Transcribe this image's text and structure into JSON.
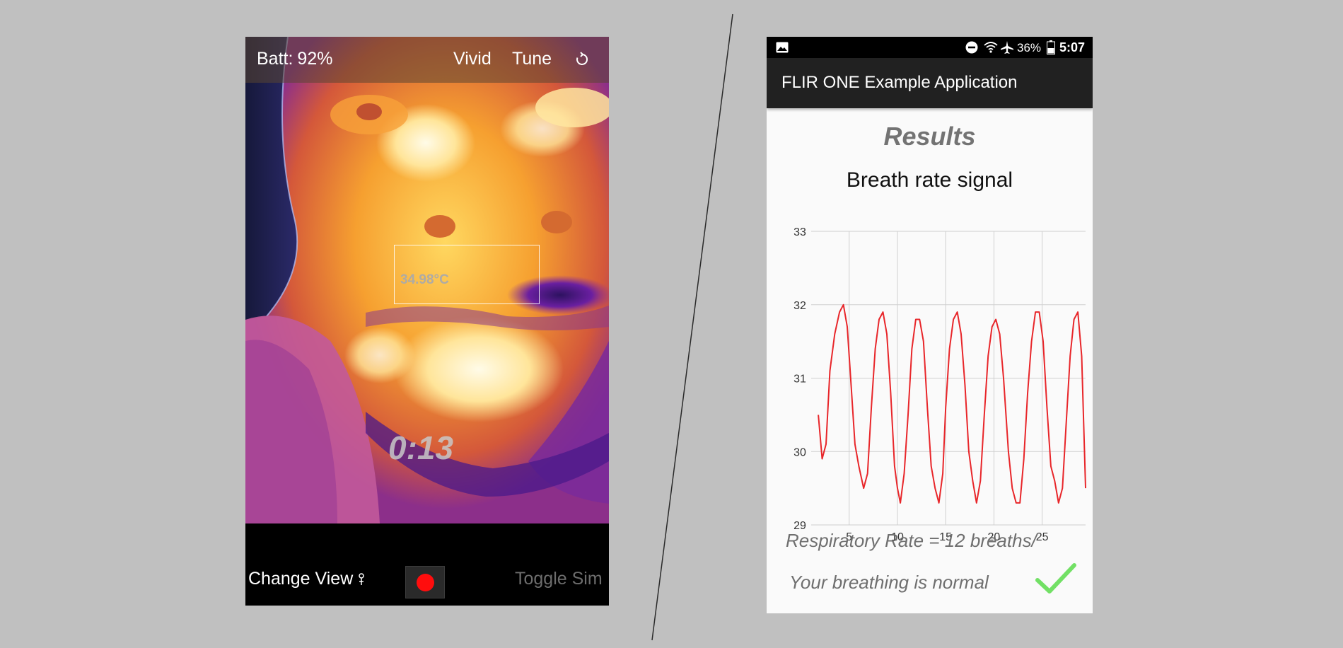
{
  "thermal_app": {
    "battery_label": "Batt:",
    "battery_value": "92%",
    "palette_label": "Vivid",
    "tune_label": "Tune",
    "roi_temperature": "34.98°C",
    "timer": "0:13",
    "change_view_label": "Change View",
    "toggle_sim_label": "Toggle Sim"
  },
  "results_app": {
    "status_bar": {
      "battery_pct": "36%",
      "time": "5:07"
    },
    "app_title": "FLIR ONE Example Application",
    "heading": "Results",
    "respiratory_rate_text": "Respiratory Rate = 12 breaths/",
    "breathing_status_text": "Your breathing is normal",
    "check_color": "#72e065"
  },
  "chart_data": {
    "type": "line",
    "title": "Breath rate signal",
    "xlabel": "",
    "ylabel": "",
    "xlim": [
      1.5,
      29.5
    ],
    "ylim": [
      29,
      33
    ],
    "x_ticks": [
      5,
      10,
      15,
      20,
      25
    ],
    "y_ticks": [
      29,
      30,
      31,
      32,
      33
    ],
    "grid": true,
    "series": [
      {
        "color": "#e8262a",
        "x": [
          1.8,
          2.2,
          2.6,
          3.0,
          3.5,
          4.0,
          4.4,
          4.8,
          5.2,
          5.6,
          6.0,
          6.5,
          6.9,
          7.3,
          7.7,
          8.1,
          8.5,
          8.9,
          9.3,
          9.7,
          10.0,
          10.3,
          10.7,
          11.1,
          11.5,
          11.9,
          12.3,
          12.7,
          13.1,
          13.5,
          13.9,
          14.3,
          14.7,
          15.0,
          15.4,
          15.8,
          16.2,
          16.6,
          17.0,
          17.4,
          17.8,
          18.2,
          18.6,
          19.0,
          19.4,
          19.8,
          20.2,
          20.6,
          21.0,
          21.5,
          21.9,
          22.3,
          22.7,
          23.1,
          23.5,
          23.9,
          24.3,
          24.7,
          25.1,
          25.5,
          25.9,
          26.3,
          26.7,
          27.1,
          27.5,
          27.9,
          28.3,
          28.7,
          29.1,
          29.5
        ],
        "y": [
          30.5,
          29.9,
          30.1,
          31.1,
          31.6,
          31.9,
          32.0,
          31.7,
          30.9,
          30.1,
          29.8,
          29.5,
          29.7,
          30.6,
          31.4,
          31.8,
          31.9,
          31.6,
          30.8,
          29.8,
          29.5,
          29.3,
          29.7,
          30.5,
          31.4,
          31.8,
          31.8,
          31.5,
          30.6,
          29.8,
          29.5,
          29.3,
          29.7,
          30.6,
          31.4,
          31.8,
          31.9,
          31.6,
          30.9,
          30.0,
          29.6,
          29.3,
          29.6,
          30.5,
          31.3,
          31.7,
          31.8,
          31.6,
          31.0,
          30.0,
          29.5,
          29.3,
          29.3,
          29.9,
          30.8,
          31.5,
          31.9,
          31.9,
          31.5,
          30.6,
          29.8,
          29.6,
          29.3,
          29.5,
          30.4,
          31.3,
          31.8,
          31.9,
          31.3,
          29.5
        ]
      }
    ]
  }
}
